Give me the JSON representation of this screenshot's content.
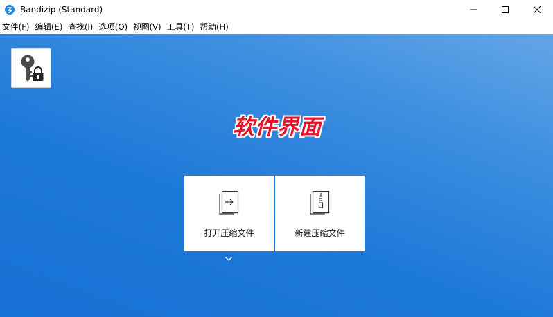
{
  "window": {
    "title": "Bandizip (Standard)",
    "app_icon": "bandizip-logo-icon",
    "controls": [
      "minimize-icon",
      "maximize-icon",
      "close-icon"
    ]
  },
  "menu": [
    {
      "label": "文件(F)"
    },
    {
      "label": "编辑(E)"
    },
    {
      "label": "查找(I)"
    },
    {
      "label": "选项(O)"
    },
    {
      "label": "视图(V)"
    },
    {
      "label": "工具(T)"
    },
    {
      "label": "帮助(H)"
    }
  ],
  "main": {
    "key_button_icon": "key-lock-icon",
    "banner_text": "软件界面",
    "actions": [
      {
        "label": "打开压缩文件",
        "icon": "open-archive-icon"
      },
      {
        "label": "新建压缩文件",
        "icon": "new-archive-icon"
      }
    ],
    "dropdown_icon": "chevron-down-icon"
  },
  "colors": {
    "background_top": "#64a6e6",
    "background_bottom": "#1671d4",
    "banner_red": "#e8132b",
    "app_icon_blue": "#1e88e5"
  }
}
